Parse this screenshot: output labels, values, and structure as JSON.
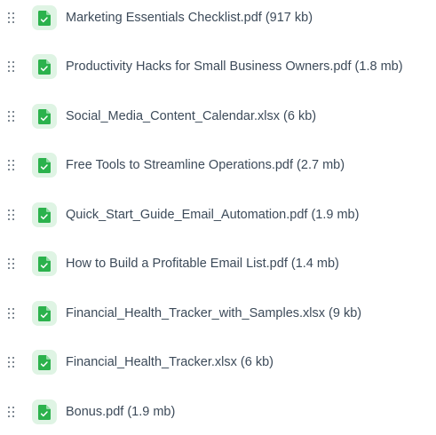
{
  "icon": "file-document-icon",
  "colors": {
    "icon_accent": "#2bb24c",
    "icon_background": "#dff4e4",
    "text": "#3c4a59",
    "handle": "#556270"
  },
  "files": [
    {
      "label": "Marketing Essentials Checklist.pdf (917 kb)"
    },
    {
      "label": "Productivity Hacks for Small Business Owners.pdf (1.8 mb)"
    },
    {
      "label": "Social_Media_Content_Calendar.xlsx (6 kb)"
    },
    {
      "label": "Free Tools to Streamline Operations.pdf (2.7 mb)"
    },
    {
      "label": "Quick_Start_Guide_Email_Automation.pdf (1.9 mb)"
    },
    {
      "label": "How to Build a Profitable Email List.pdf (1.4 mb)"
    },
    {
      "label": "Financial_Health_Tracker_with_Samples.xlsx (9 kb)"
    },
    {
      "label": "Financial_Health_Tracker.xlsx (6 kb)"
    },
    {
      "label": "Bonus.pdf (1.9 mb)"
    }
  ]
}
